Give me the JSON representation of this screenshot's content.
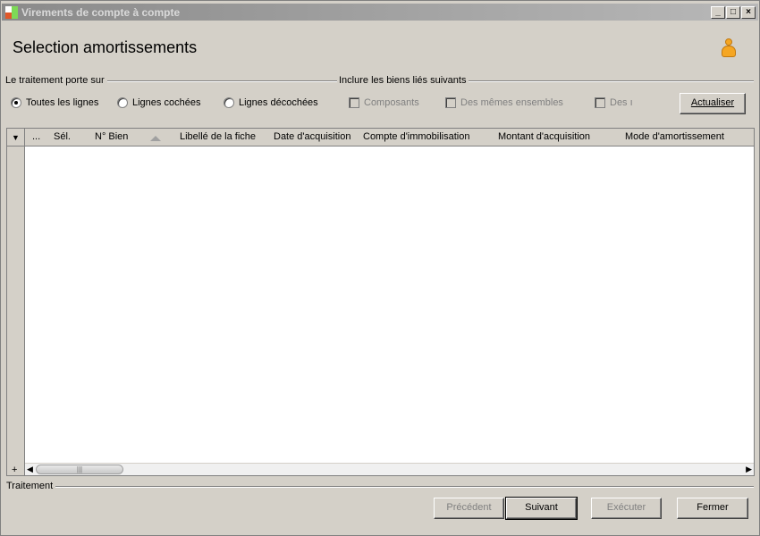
{
  "window": {
    "title": "Virements de compte à compte",
    "minimize_glyph": "_",
    "maximize_glyph": "□",
    "close_glyph": "×"
  },
  "header": {
    "title": "Selection amortissements",
    "user_icon": "person-icon"
  },
  "scope_group": {
    "label": "Le traitement porte sur",
    "options": [
      {
        "label": "Toutes les lignes",
        "selected": true
      },
      {
        "label": "Lignes cochées",
        "selected": false
      },
      {
        "label": "Lignes décochées",
        "selected": false
      }
    ]
  },
  "linked_group": {
    "label": "Inclure les biens liés suivants",
    "options": [
      {
        "label": "Composants",
        "checked": false,
        "enabled": false
      },
      {
        "label": "Des mêmes ensembles",
        "checked": false,
        "enabled": false
      },
      {
        "label": "Des ı",
        "checked": false,
        "enabled": false
      }
    ]
  },
  "refresh_button": {
    "label": "Actualiser",
    "underlined_letter": "A"
  },
  "grid": {
    "column_menu_glyph": "▼",
    "columns": [
      "...",
      "Sél.",
      "N° Bien",
      "Libellé de  la fiche",
      "Date d'acquisition",
      "Compte d'immobilisation",
      "Montant d'acquisition",
      "Mode d'amortissement"
    ],
    "sorted_column": "N° Bien",
    "rows": [],
    "add_row_glyph": "+",
    "scroll_thumb_glyph": "|||"
  },
  "footer": {
    "status_label": "Traitement",
    "buttons": [
      {
        "label": "Précédent",
        "enabled": false
      },
      {
        "label": "Suivant",
        "enabled": true
      },
      {
        "label": "Exécuter",
        "enabled": false
      },
      {
        "label": "Fermer",
        "enabled": true
      }
    ]
  }
}
